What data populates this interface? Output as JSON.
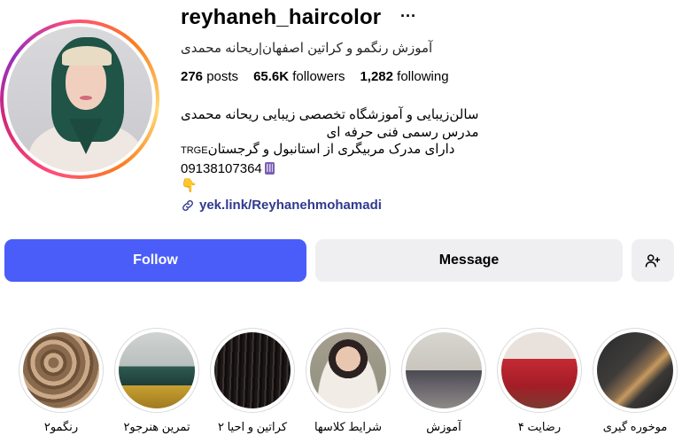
{
  "profile": {
    "username": "reyhaneh_haircolor",
    "full_name": "آموزش رنگمو و کراتین اصفهان|ریحانه محمدی",
    "stats": {
      "posts_count": "276",
      "posts_label": "posts",
      "followers_count": "65.6K",
      "followers_label": "followers",
      "following_count": "1,282",
      "following_label": "following"
    },
    "bio": [
      "سالن‌زیبایی و آموزشگاه تخصصی زیبایی ریحانه محمدی",
      "مدرس رسمی فنی حرفه ای",
      "دارای مدرک مربیگری از استانبول و گرجستان",
      "09138107364",
      "👇"
    ],
    "bio_badge": "TRGE",
    "link": "yek.link/Reyhanehmohamadi"
  },
  "actions": {
    "follow_label": "Follow",
    "message_label": "Message"
  },
  "highlights": [
    {
      "label": "رنگمو۲"
    },
    {
      "label": "تمرین هنرجو۲"
    },
    {
      "label": "کراتین و احیا ۲"
    },
    {
      "label": "شرایط کلاسها"
    },
    {
      "label": "آموزش"
    },
    {
      "label": "رضایت ۴"
    },
    {
      "label": "موخوره گیری"
    }
  ],
  "colors": {
    "follow_button": "#4a5df9",
    "secondary_button": "#efeff1",
    "link": "#2f3a8f",
    "story_ring": "#dbdbdb"
  },
  "icons": {
    "more": "more-horizontal-icon",
    "link": "link-chain-icon",
    "add_user": "add-user-icon",
    "phone": "mobile-phone-icon"
  }
}
